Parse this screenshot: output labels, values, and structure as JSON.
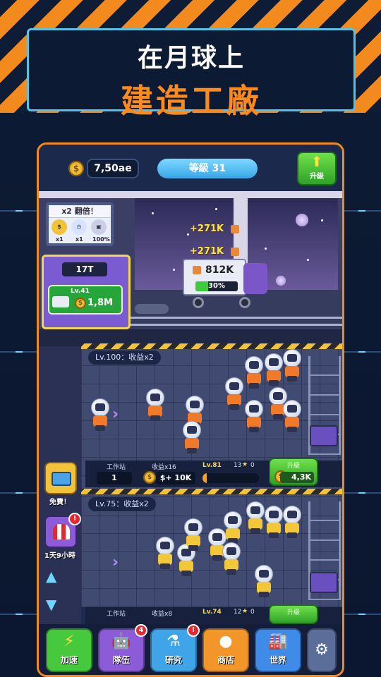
{
  "banner": {
    "line1": "在月球上",
    "line2": "建造工廠"
  },
  "header": {
    "money": "7,50ae",
    "level_label": "等級 31",
    "upgrade_label": "升級",
    "coin_icon": "coin-icon",
    "upgrade_icon": "up-arrow-icon"
  },
  "surface": {
    "bonus_board_title": "x2 翻倍！",
    "bonus_items": [
      {
        "icon": "coin-icon",
        "caption": "x1"
      },
      {
        "icon": "clock-icon",
        "caption": "x1"
      },
      {
        "icon": "robot-icon",
        "caption": "100%"
      }
    ],
    "elevator_amount": "17T",
    "elevator_level": "Lv.41",
    "elevator_value": "1,8M",
    "float_gain_1": "+271K",
    "float_gain_2": "+271K",
    "truck_amount": "812K",
    "truck_progress_pct": 30,
    "truck_progress_label": "30%"
  },
  "floors": [
    {
      "tag": "Lv.100：收益x2",
      "station_label": "工作站",
      "station_value": "1",
      "income_label": "收益x16",
      "income_value": "$+ 10K",
      "level": "Lv.81",
      "workers": "13",
      "stars": "0",
      "upgrade_label": "升級",
      "upgrade_cost": "4,3K"
    },
    {
      "tag": "Lv.75：收益x2",
      "station_label": "工作站",
      "income_label": "收益x8",
      "level": "Lv.74",
      "workers": "12",
      "stars": "0",
      "upgrade_label": "升級"
    }
  ],
  "side": {
    "free_label": "免費！",
    "timer_label": "1天9小時",
    "badge": "!"
  },
  "nav": [
    {
      "label": "加速",
      "icon": "lightning-icon",
      "color": "#46c93d"
    },
    {
      "label": "隊伍",
      "icon": "robot-icon",
      "color": "#8b5bd8",
      "badge": "4"
    },
    {
      "label": "研究",
      "icon": "flask-icon",
      "color": "#3fa4e8",
      "badge": "!"
    },
    {
      "label": "商店",
      "icon": "coins-icon",
      "color": "#f3962a"
    },
    {
      "label": "世界",
      "icon": "factory-icon",
      "color": "#3f8be8"
    },
    {
      "label": "",
      "icon": "gear-icon",
      "color": "#5b6d99"
    }
  ]
}
